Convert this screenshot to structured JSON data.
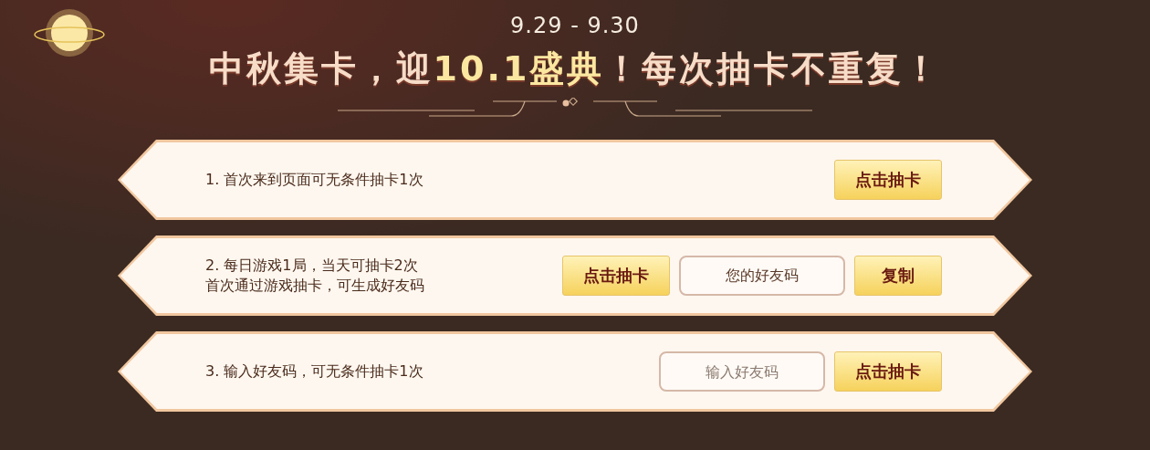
{
  "header": {
    "date_range": "9.29 - 9.30",
    "title_parts": [
      {
        "text": "中秋集卡，迎",
        "kind": "plain"
      },
      {
        "text": "10.1盛典",
        "kind": "highlight"
      },
      {
        "text": "！每次抽卡不重复！",
        "kind": "plain"
      }
    ]
  },
  "tasks": [
    {
      "lines": [
        "1. 首次来到页面可无条件抽卡1次"
      ],
      "controls": [
        {
          "kind": "button",
          "label": "点击抽卡"
        }
      ]
    },
    {
      "lines": [
        "2. 每日游戏1局，当天可抽卡2次",
        "首次通过游戏抽卡，可生成好友码"
      ],
      "controls": [
        {
          "kind": "button",
          "label": "点击抽卡"
        },
        {
          "kind": "field",
          "value": "您的好友码"
        },
        {
          "kind": "button",
          "label": "复制"
        }
      ]
    },
    {
      "lines": [
        "3. 输入好友码，可无条件抽卡1次"
      ],
      "controls": [
        {
          "kind": "field",
          "placeholder": "输入好友码"
        },
        {
          "kind": "button",
          "label": "点击抽卡"
        }
      ]
    }
  ]
}
